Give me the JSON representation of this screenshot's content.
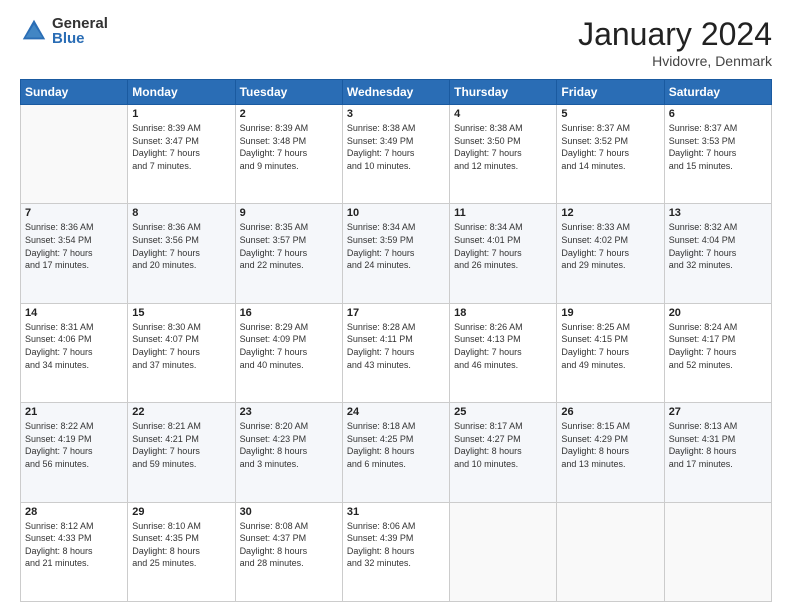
{
  "logo": {
    "general": "General",
    "blue": "Blue"
  },
  "header": {
    "month": "January 2024",
    "location": "Hvidovre, Denmark"
  },
  "weekdays": [
    "Sunday",
    "Monday",
    "Tuesday",
    "Wednesday",
    "Thursday",
    "Friday",
    "Saturday"
  ],
  "weeks": [
    [
      {
        "day": "",
        "info": ""
      },
      {
        "day": "1",
        "info": "Sunrise: 8:39 AM\nSunset: 3:47 PM\nDaylight: 7 hours\nand 7 minutes."
      },
      {
        "day": "2",
        "info": "Sunrise: 8:39 AM\nSunset: 3:48 PM\nDaylight: 7 hours\nand 9 minutes."
      },
      {
        "day": "3",
        "info": "Sunrise: 8:38 AM\nSunset: 3:49 PM\nDaylight: 7 hours\nand 10 minutes."
      },
      {
        "day": "4",
        "info": "Sunrise: 8:38 AM\nSunset: 3:50 PM\nDaylight: 7 hours\nand 12 minutes."
      },
      {
        "day": "5",
        "info": "Sunrise: 8:37 AM\nSunset: 3:52 PM\nDaylight: 7 hours\nand 14 minutes."
      },
      {
        "day": "6",
        "info": "Sunrise: 8:37 AM\nSunset: 3:53 PM\nDaylight: 7 hours\nand 15 minutes."
      }
    ],
    [
      {
        "day": "7",
        "info": "Sunrise: 8:36 AM\nSunset: 3:54 PM\nDaylight: 7 hours\nand 17 minutes."
      },
      {
        "day": "8",
        "info": "Sunrise: 8:36 AM\nSunset: 3:56 PM\nDaylight: 7 hours\nand 20 minutes."
      },
      {
        "day": "9",
        "info": "Sunrise: 8:35 AM\nSunset: 3:57 PM\nDaylight: 7 hours\nand 22 minutes."
      },
      {
        "day": "10",
        "info": "Sunrise: 8:34 AM\nSunset: 3:59 PM\nDaylight: 7 hours\nand 24 minutes."
      },
      {
        "day": "11",
        "info": "Sunrise: 8:34 AM\nSunset: 4:01 PM\nDaylight: 7 hours\nand 26 minutes."
      },
      {
        "day": "12",
        "info": "Sunrise: 8:33 AM\nSunset: 4:02 PM\nDaylight: 7 hours\nand 29 minutes."
      },
      {
        "day": "13",
        "info": "Sunrise: 8:32 AM\nSunset: 4:04 PM\nDaylight: 7 hours\nand 32 minutes."
      }
    ],
    [
      {
        "day": "14",
        "info": "Sunrise: 8:31 AM\nSunset: 4:06 PM\nDaylight: 7 hours\nand 34 minutes."
      },
      {
        "day": "15",
        "info": "Sunrise: 8:30 AM\nSunset: 4:07 PM\nDaylight: 7 hours\nand 37 minutes."
      },
      {
        "day": "16",
        "info": "Sunrise: 8:29 AM\nSunset: 4:09 PM\nDaylight: 7 hours\nand 40 minutes."
      },
      {
        "day": "17",
        "info": "Sunrise: 8:28 AM\nSunset: 4:11 PM\nDaylight: 7 hours\nand 43 minutes."
      },
      {
        "day": "18",
        "info": "Sunrise: 8:26 AM\nSunset: 4:13 PM\nDaylight: 7 hours\nand 46 minutes."
      },
      {
        "day": "19",
        "info": "Sunrise: 8:25 AM\nSunset: 4:15 PM\nDaylight: 7 hours\nand 49 minutes."
      },
      {
        "day": "20",
        "info": "Sunrise: 8:24 AM\nSunset: 4:17 PM\nDaylight: 7 hours\nand 52 minutes."
      }
    ],
    [
      {
        "day": "21",
        "info": "Sunrise: 8:22 AM\nSunset: 4:19 PM\nDaylight: 7 hours\nand 56 minutes."
      },
      {
        "day": "22",
        "info": "Sunrise: 8:21 AM\nSunset: 4:21 PM\nDaylight: 7 hours\nand 59 minutes."
      },
      {
        "day": "23",
        "info": "Sunrise: 8:20 AM\nSunset: 4:23 PM\nDaylight: 8 hours\nand 3 minutes."
      },
      {
        "day": "24",
        "info": "Sunrise: 8:18 AM\nSunset: 4:25 PM\nDaylight: 8 hours\nand 6 minutes."
      },
      {
        "day": "25",
        "info": "Sunrise: 8:17 AM\nSunset: 4:27 PM\nDaylight: 8 hours\nand 10 minutes."
      },
      {
        "day": "26",
        "info": "Sunrise: 8:15 AM\nSunset: 4:29 PM\nDaylight: 8 hours\nand 13 minutes."
      },
      {
        "day": "27",
        "info": "Sunrise: 8:13 AM\nSunset: 4:31 PM\nDaylight: 8 hours\nand 17 minutes."
      }
    ],
    [
      {
        "day": "28",
        "info": "Sunrise: 8:12 AM\nSunset: 4:33 PM\nDaylight: 8 hours\nand 21 minutes."
      },
      {
        "day": "29",
        "info": "Sunrise: 8:10 AM\nSunset: 4:35 PM\nDaylight: 8 hours\nand 25 minutes."
      },
      {
        "day": "30",
        "info": "Sunrise: 8:08 AM\nSunset: 4:37 PM\nDaylight: 8 hours\nand 28 minutes."
      },
      {
        "day": "31",
        "info": "Sunrise: 8:06 AM\nSunset: 4:39 PM\nDaylight: 8 hours\nand 32 minutes."
      },
      {
        "day": "",
        "info": ""
      },
      {
        "day": "",
        "info": ""
      },
      {
        "day": "",
        "info": ""
      }
    ]
  ]
}
